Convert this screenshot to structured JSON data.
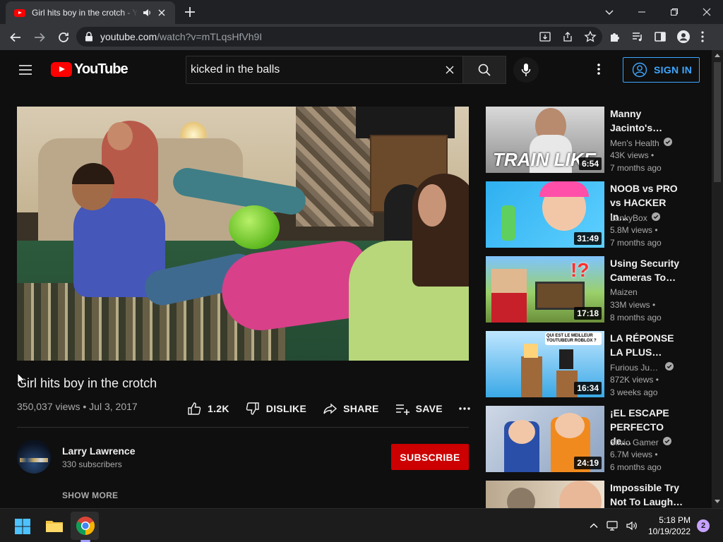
{
  "browser": {
    "tab_title": "Girl hits boy in the crotch - YouTube",
    "url_main": "youtube.com",
    "url_path": "/watch?v=mTLqsHfVh9I"
  },
  "youtube": {
    "logo_text": "YouTube",
    "search_value": "kicked in the balls",
    "sign_in": "SIGN IN"
  },
  "video": {
    "title": "Girl hits boy in the crotch",
    "meta": "350,037 views • Jul 3, 2017",
    "like_count": "1.2K",
    "dislike": "DISLIKE",
    "share": "SHARE",
    "save": "SAVE",
    "channel_name": "Larry Lawrence",
    "channel_subs": "330 subscribers",
    "subscribe": "SUBSCRIBE",
    "show_more": "SHOW MORE"
  },
  "recommendations": [
    {
      "title": "Manny Jacinto's…",
      "channel": "Men's Health",
      "verified": true,
      "views": "43K views •",
      "ago": "7 months ago",
      "duration": "6:54",
      "thumb_text": "TRAIN LIKE"
    },
    {
      "title": "NOOB vs PRO vs HACKER In…",
      "channel": "LankyBox",
      "verified": true,
      "views": "5.8M views •",
      "ago": "7 months ago",
      "duration": "31:49",
      "thumb_text": ""
    },
    {
      "title": "Using Security Cameras To…",
      "channel": "Maizen",
      "verified": false,
      "views": "33M views •",
      "ago": "8 months ago",
      "duration": "17:18",
      "thumb_text": "!?"
    },
    {
      "title": "LA RÉPONSE LA PLUS…",
      "channel": "Furious Ju…",
      "verified": true,
      "views": "872K views •",
      "ago": "3 weeks ago",
      "duration": "16:34",
      "thumb_text": "QUI EST LE MEILLEUR YOUTUBEUR ROBLOX ?"
    },
    {
      "title": "¡EL ESCAPE PERFECTO de…",
      "channel": "Silvio Gamer",
      "verified": true,
      "views": "6.7M views •",
      "ago": "6 months ago",
      "duration": "24:19",
      "thumb_text": ""
    },
    {
      "title": "Impossible Try Not To Laugh…",
      "channel": "",
      "verified": false,
      "views": "",
      "ago": "",
      "duration": "",
      "thumb_text": ""
    }
  ],
  "taskbar": {
    "time": "5:18 PM",
    "date": "10/19/2022",
    "notifications": "2"
  }
}
